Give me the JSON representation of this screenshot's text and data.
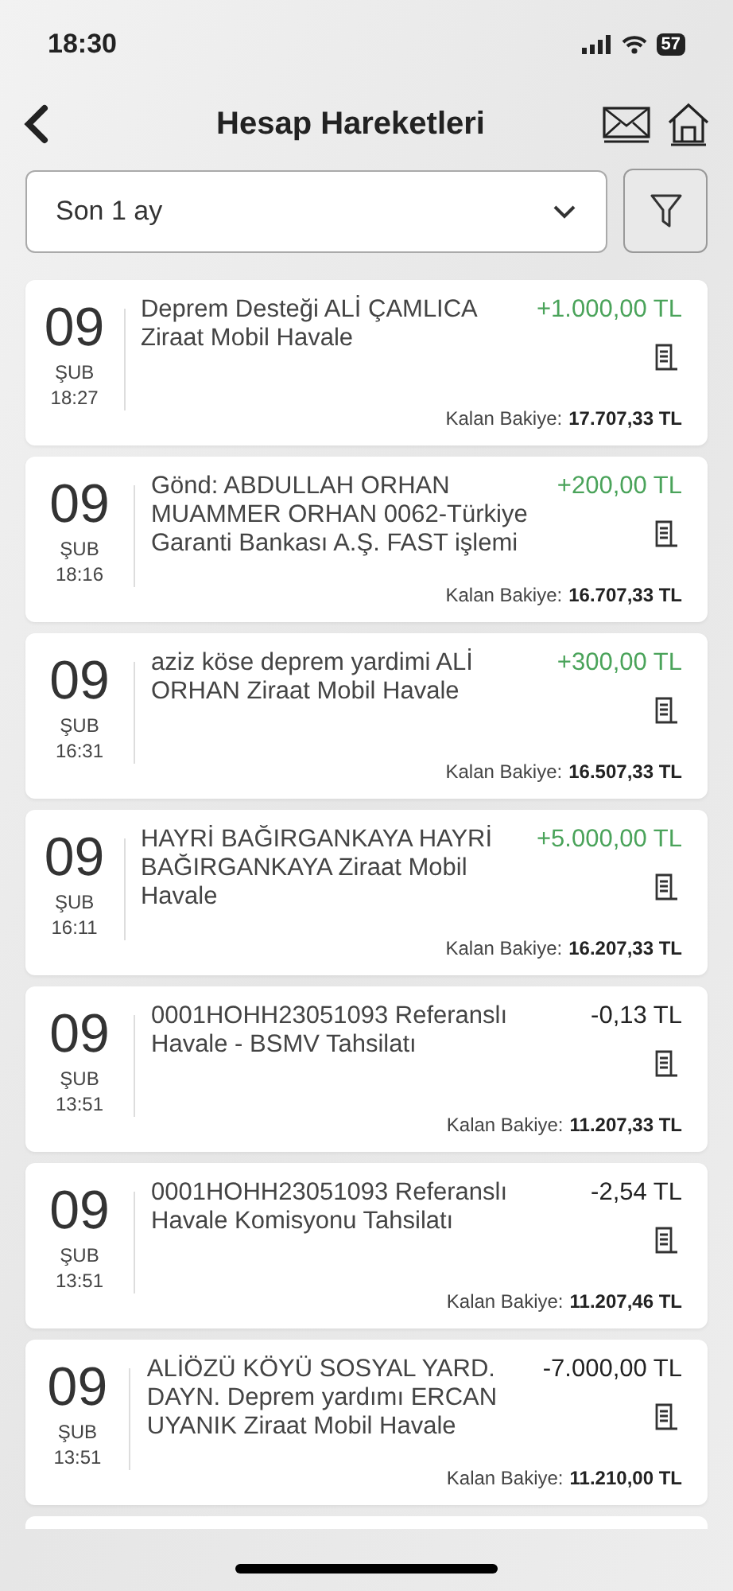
{
  "status_bar": {
    "time": "18:30",
    "battery": "57"
  },
  "header": {
    "title": "Hesap Hareketleri"
  },
  "period_select": {
    "value": "Son 1 ay"
  },
  "transactions": [
    {
      "day": "09",
      "month": "ŞUB",
      "time": "18:27",
      "description": "Deprem Desteği ALİ ÇAMLICA Ziraat Mobil Havale",
      "amount": "+1.000,00 TL",
      "kind": "credit",
      "balance_label": "Kalan Bakiye:",
      "balance": "17.707,33 TL"
    },
    {
      "day": "09",
      "month": "ŞUB",
      "time": "18:16",
      "description": "Gönd: ABDULLAH ORHAN MUAMMER ORHAN 0062-Türkiye Garanti Bankası A.Ş. FAST işlemi",
      "amount": "+200,00 TL",
      "kind": "credit",
      "balance_label": "Kalan Bakiye:",
      "balance": "16.707,33 TL"
    },
    {
      "day": "09",
      "month": "ŞUB",
      "time": "16:31",
      "description": "aziz köse deprem yardimi ALİ ORHAN Ziraat Mobil Havale",
      "amount": "+300,00 TL",
      "kind": "credit",
      "balance_label": "Kalan Bakiye:",
      "balance": "16.507,33 TL"
    },
    {
      "day": "09",
      "month": "ŞUB",
      "time": "16:11",
      "description": "HAYRİ BAĞIRGANKAYA HAYRİ BAĞIRGANKAYA Ziraat Mobil Havale",
      "amount": "+5.000,00 TL",
      "kind": "credit",
      "balance_label": "Kalan Bakiye:",
      "balance": "16.207,33 TL"
    },
    {
      "day": "09",
      "month": "ŞUB",
      "time": "13:51",
      "description": "0001HOHH23051093 Referanslı Havale - BSMV Tahsilatı",
      "amount": "-0,13 TL",
      "kind": "debit",
      "balance_label": "Kalan Bakiye:",
      "balance": "11.207,33 TL"
    },
    {
      "day": "09",
      "month": "ŞUB",
      "time": "13:51",
      "description": "0001HOHH23051093 Referanslı Havale Komisyonu Tahsilatı",
      "amount": "-2,54 TL",
      "kind": "debit",
      "balance_label": "Kalan Bakiye:",
      "balance": "11.207,46 TL"
    },
    {
      "day": "09",
      "month": "ŞUB",
      "time": "13:51",
      "description": "ALİÖZÜ KÖYÜ SOSYAL YARD. DAYN. Deprem yardımı ERCAN UYANIK Ziraat Mobil Havale",
      "amount": "-7.000,00 TL",
      "kind": "debit",
      "balance_label": "Kalan Bakiye:",
      "balance": "11.210,00 TL"
    }
  ]
}
